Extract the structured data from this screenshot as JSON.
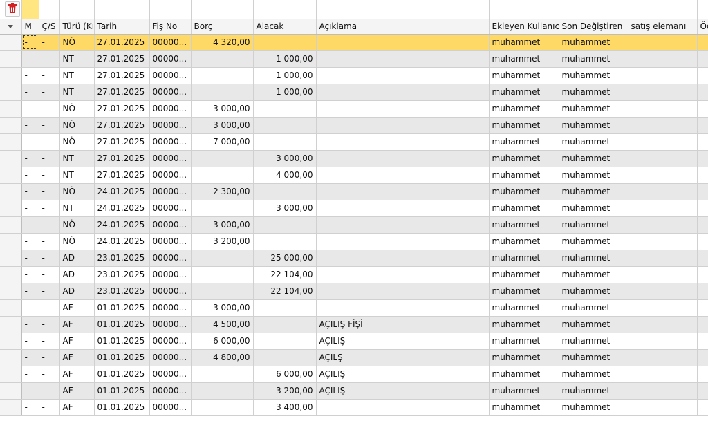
{
  "toolbar": {
    "delete_icon": "trash-icon"
  },
  "columns": [
    "M",
    "Ç/S",
    "Türü (Kı",
    "Tarih",
    "Fiş No",
    "Borç",
    "Alacak",
    "Açıklama",
    "Ekleyen Kullanıcı",
    "Son Değiştiren",
    "satış elemanı",
    "Öde"
  ],
  "rows": [
    [
      "-",
      "-",
      "NÖ",
      "27.01.2025",
      "00000...",
      "4 320,00",
      "",
      "",
      "muhammet",
      "muhammet",
      "",
      ""
    ],
    [
      "-",
      "-",
      "NT",
      "27.01.2025",
      "00000...",
      "",
      "1 000,00",
      "",
      "muhammet",
      "muhammet",
      "",
      ""
    ],
    [
      "-",
      "-",
      "NT",
      "27.01.2025",
      "00000...",
      "",
      "1 000,00",
      "",
      "muhammet",
      "muhammet",
      "",
      ""
    ],
    [
      "-",
      "-",
      "NT",
      "27.01.2025",
      "00000...",
      "",
      "1 000,00",
      "",
      "muhammet",
      "muhammet",
      "",
      ""
    ],
    [
      "-",
      "-",
      "NÖ",
      "27.01.2025",
      "00000...",
      "3 000,00",
      "",
      "",
      "muhammet",
      "muhammet",
      "",
      ""
    ],
    [
      "-",
      "-",
      "NÖ",
      "27.01.2025",
      "00000...",
      "3 000,00",
      "",
      "",
      "muhammet",
      "muhammet",
      "",
      ""
    ],
    [
      "-",
      "-",
      "NÖ",
      "27.01.2025",
      "00000...",
      "7 000,00",
      "",
      "",
      "muhammet",
      "muhammet",
      "",
      ""
    ],
    [
      "-",
      "-",
      "NT",
      "27.01.2025",
      "00000...",
      "",
      "3 000,00",
      "",
      "muhammet",
      "muhammet",
      "",
      ""
    ],
    [
      "-",
      "-",
      "NT",
      "27.01.2025",
      "00000...",
      "",
      "4 000,00",
      "",
      "muhammet",
      "muhammet",
      "",
      ""
    ],
    [
      "-",
      "-",
      "NÖ",
      "24.01.2025",
      "00000...",
      "2 300,00",
      "",
      "",
      "muhammet",
      "muhammet",
      "",
      ""
    ],
    [
      "-",
      "-",
      "NT",
      "24.01.2025",
      "00000...",
      "",
      "3 000,00",
      "",
      "muhammet",
      "muhammet",
      "",
      ""
    ],
    [
      "-",
      "-",
      "NÖ",
      "24.01.2025",
      "00000...",
      "3 000,00",
      "",
      "",
      "muhammet",
      "muhammet",
      "",
      ""
    ],
    [
      "-",
      "-",
      "NÖ",
      "24.01.2025",
      "00000...",
      "3 200,00",
      "",
      "",
      "muhammet",
      "muhammet",
      "",
      ""
    ],
    [
      "-",
      "-",
      "AD",
      "23.01.2025",
      "00000...",
      "",
      "25 000,00",
      "",
      "muhammet",
      "muhammet",
      "",
      ""
    ],
    [
      "-",
      "-",
      "AD",
      "23.01.2025",
      "00000...",
      "",
      "22 104,00",
      "",
      "muhammet",
      "muhammet",
      "",
      ""
    ],
    [
      "-",
      "-",
      "AD",
      "23.01.2025",
      "00000...",
      "",
      "22 104,00",
      "",
      "muhammet",
      "muhammet",
      "",
      ""
    ],
    [
      "-",
      "-",
      "AF",
      "01.01.2025",
      "00000...",
      "3 000,00",
      "",
      "",
      "muhammet",
      "muhammet",
      "",
      ""
    ],
    [
      "-",
      "-",
      "AF",
      "01.01.2025",
      "00000...",
      "4 500,00",
      "",
      "AÇILIŞ FİŞİ",
      "muhammet",
      "muhammet",
      "",
      ""
    ],
    [
      "-",
      "-",
      "AF",
      "01.01.2025",
      "00000...",
      "6 000,00",
      "",
      "AÇILIŞ",
      "muhammet",
      "muhammet",
      "",
      ""
    ],
    [
      "-",
      "-",
      "AF",
      "01.01.2025",
      "00000...",
      "4 800,00",
      "",
      "AÇILŞ",
      "muhammet",
      "muhammet",
      "",
      ""
    ],
    [
      "-",
      "-",
      "AF",
      "01.01.2025",
      "00000...",
      "",
      "6 000,00",
      "AÇILIŞ",
      "muhammet",
      "muhammet",
      "",
      ""
    ],
    [
      "-",
      "-",
      "AF",
      "01.01.2025",
      "00000...",
      "",
      "3 200,00",
      "AÇILIŞ",
      "muhammet",
      "muhammet",
      "",
      ""
    ],
    [
      "-",
      "-",
      "AF",
      "01.01.2025",
      "00000...",
      "",
      "3 400,00",
      "",
      "muhammet",
      "muhammet",
      "",
      ""
    ]
  ],
  "selected_row": 0,
  "colors": {
    "selection": "#ffd966",
    "alt_row": "#e8e8e8",
    "trash": "#d42020"
  }
}
